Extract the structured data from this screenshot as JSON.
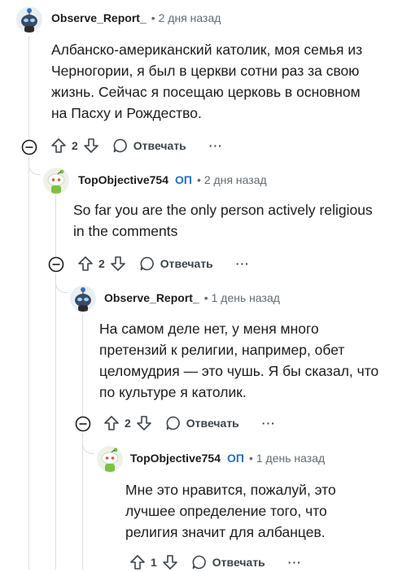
{
  "comments": [
    {
      "author": "Observe_Report_",
      "op_badge": "",
      "sep": "•",
      "time": "2 дня назад",
      "lines": [
        "Албанско-американский католик, моя семья из",
        "Черногории, я был в церкви сотни раз за свою",
        "жизнь. Сейчас я посещаю церковь в основном",
        "на Пасху и Рождество."
      ],
      "votes": "2",
      "reply_label": "Отвечать",
      "more": "···"
    },
    {
      "author": "TopObjective754",
      "op_badge": "ОП",
      "sep": "•",
      "time": "2 дня назад",
      "lines": [
        "So far you are the only person actively religious",
        "in the comments"
      ],
      "votes": "2",
      "reply_label": "Отвечать",
      "more": "···"
    },
    {
      "author": "Observe_Report_",
      "op_badge": "",
      "sep": "•",
      "time": "1 день назад",
      "lines": [
        "На самом деле нет, у меня много",
        "претензий к религии, например, обет",
        "целомудрия — это чушь. Я бы сказал, что",
        "по культуре я католик."
      ],
      "votes": "2",
      "reply_label": "Отвечать",
      "more": "···"
    },
    {
      "author": "TopObjective754",
      "op_badge": "ОП",
      "sep": "•",
      "time": "1 день назад",
      "lines": [
        "Мне это нравится, пожалуй, это",
        "лучшее определение того, что",
        "религия значит для албанцев."
      ],
      "votes": "1",
      "reply_label": "Отвечать",
      "more": "···"
    }
  ],
  "colors": {
    "op_badge": "#1f6fd1",
    "thread_line": "#d9dde0",
    "avatar_observe": "#3a4a66",
    "avatar_top": "#7bc043"
  },
  "icons": {
    "avatar_1": "alien-snoo-avatar",
    "avatar_2": "green-snoo-avatar",
    "upvote": "upvote-arrow-icon",
    "downvote": "downvote-arrow-icon",
    "reply": "speech-bubble-icon",
    "collapse": "minus-circle-icon",
    "more": "ellipsis-icon"
  }
}
